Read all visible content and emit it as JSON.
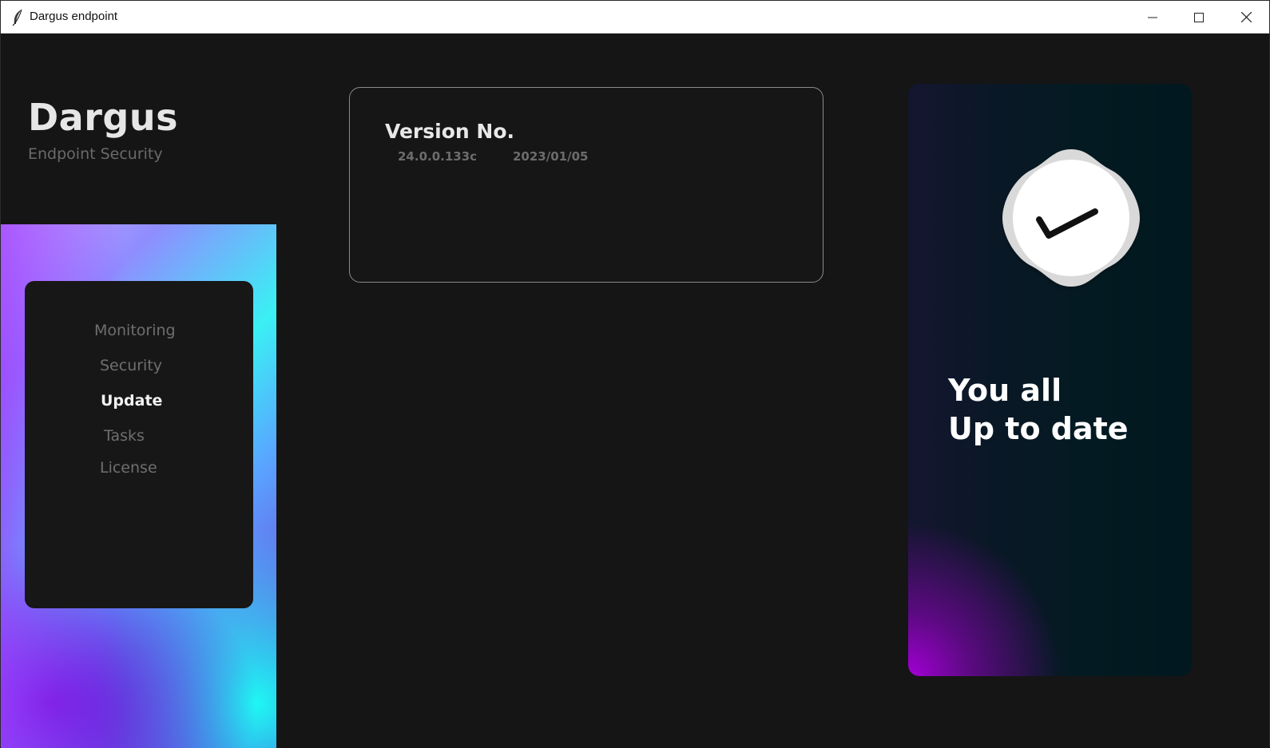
{
  "window": {
    "title": "Dargus endpoint",
    "icon": "feather-icon",
    "controls": [
      "minimize-icon",
      "maximize-icon",
      "close-icon"
    ]
  },
  "brand": {
    "name": "Dargus",
    "subtitle": "Endpoint Security"
  },
  "sidebar": {
    "items": [
      {
        "label": "Monitoring",
        "active": false
      },
      {
        "label": "Security",
        "active": false
      },
      {
        "label": "Update",
        "active": true
      },
      {
        "label": "Tasks",
        "active": false
      },
      {
        "label": "License",
        "active": false
      }
    ]
  },
  "version_card": {
    "title": "Version No.",
    "number": "24.0.0.133c",
    "date": "2023/01/05"
  },
  "status_card": {
    "icon": "check-icon",
    "line1": "You all",
    "line2": "Up to date"
  },
  "colors": {
    "background": "#151515",
    "accent_cyan": "#1ef8f3",
    "accent_purple": "#a100d4"
  }
}
